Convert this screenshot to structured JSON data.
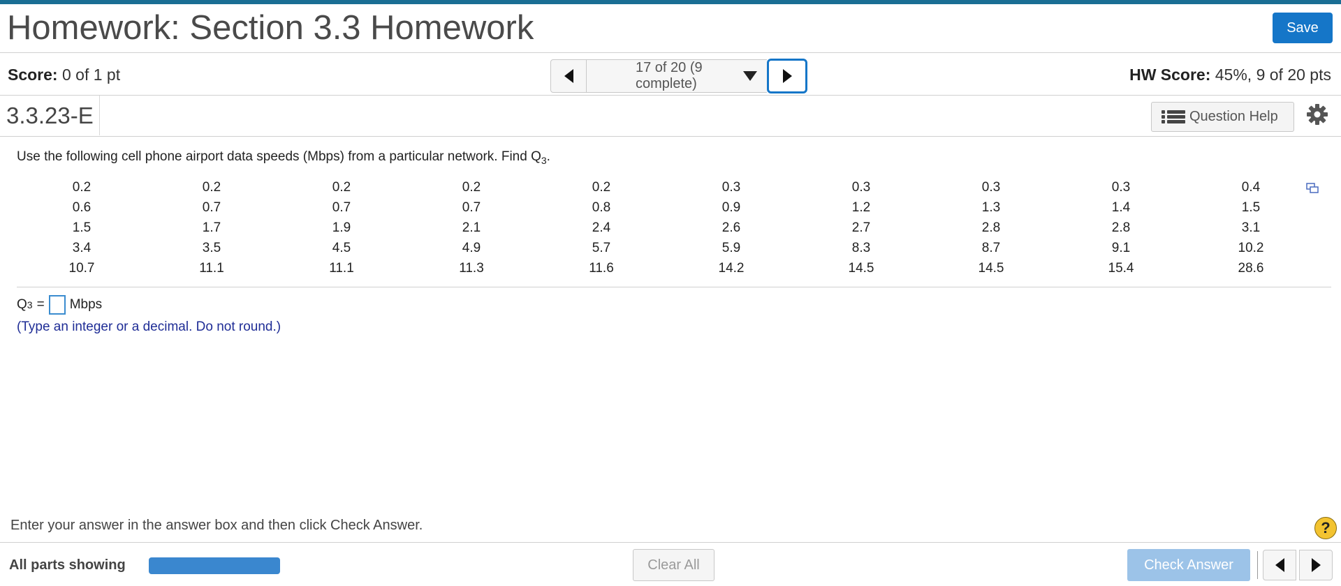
{
  "header": {
    "title": "Homework: Section 3.3 Homework",
    "save_label": "Save",
    "accent_color": "#1a6e94",
    "button_color": "#1576c8"
  },
  "score_bar": {
    "score_label": "Score:",
    "score_value": "0 of 1 pt",
    "position_text": "17 of 20 (9 complete)",
    "hw_score_label": "HW Score:",
    "hw_score_value": "45%, 9 of 20 pts"
  },
  "question": {
    "id": "3.3.23-E",
    "help_label": "Question Help",
    "prompt_text": "Use the following cell phone airport data speeds (Mbps) from a particular network. Find Q",
    "prompt_sub": "3",
    "prompt_end": ".",
    "data_rows": [
      [
        "0.2",
        "0.2",
        "0.2",
        "0.2",
        "0.2",
        "0.3",
        "0.3",
        "0.3",
        "0.3",
        "0.4"
      ],
      [
        "0.6",
        "0.7",
        "0.7",
        "0.7",
        "0.8",
        "0.9",
        "1.2",
        "1.3",
        "1.4",
        "1.5"
      ],
      [
        "1.5",
        "1.7",
        "1.9",
        "2.1",
        "2.4",
        "2.6",
        "2.7",
        "2.8",
        "2.8",
        "3.1"
      ],
      [
        "3.4",
        "3.5",
        "4.5",
        "4.9",
        "5.7",
        "5.9",
        "8.3",
        "8.7",
        "9.1",
        "10.2"
      ],
      [
        "10.7",
        "11.1",
        "11.1",
        "11.3",
        "11.6",
        "14.2",
        "14.5",
        "14.5",
        "15.4",
        "28.6"
      ]
    ],
    "answer_prefix": "Q",
    "answer_sub": "3",
    "answer_eq": "=",
    "answer_value": "",
    "answer_unit": "Mbps",
    "hint": "(Type an integer or a decimal. Do not round.)"
  },
  "footer": {
    "instructions": "Enter your answer in the answer box and then click Check Answer.",
    "help_symbol": "?",
    "parts_label": "All parts showing",
    "clear_label": "Clear All",
    "check_label": "Check Answer"
  },
  "icons": {
    "prev": "triangle-left-icon",
    "next": "triangle-right-icon",
    "dropdown": "caret-down-icon",
    "list": "list-icon",
    "settings": "gear-icon",
    "copy": "copy-icon",
    "help": "help-circle-icon"
  }
}
